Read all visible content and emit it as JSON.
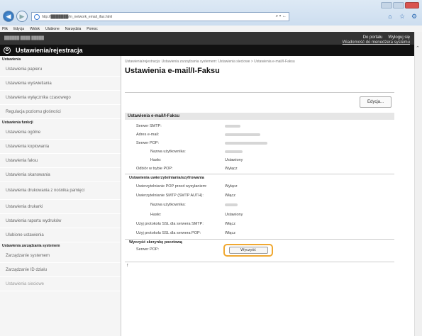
{
  "browser": {
    "url": "http://███████/m_network_email_ifax.html",
    "addr_controls": "⌕ ▾ ←",
    "menu": [
      "Plik",
      "Edycja",
      "Widok",
      "Ulubione",
      "Narzędzia",
      "Pomoc"
    ]
  },
  "topbar": {
    "device": "██████ ████ █████",
    "portal": "Do portalu",
    "logout": "Wyloguj się",
    "manager_msg": "Wiadomość do menedżera systemu"
  },
  "app": {
    "title": "Ustawienia/rejestracja"
  },
  "sidebar": {
    "group1": "Ustawienia",
    "items1": [
      "Ustawienia papieru",
      "Ustawienia wyświetlania",
      "Ustawienia wyłącznika czasowego",
      "Regulacja poziomu głośności"
    ],
    "group2": "Ustawienia funkcji",
    "items2": [
      "Ustawienia ogólne",
      "Ustawienia kopiowania",
      "Ustawienia faksu",
      "Ustawienia skanowania",
      "Ustawienia drukowania z nośnika pamięci",
      "Ustawienia drukarki",
      "Ustawienia raportu wydruków",
      "Ulubione ustawienia"
    ],
    "group3": "Ustawienia zarządzania systemem",
    "items3": [
      "Zarządzanie systemem",
      "Zarządzanie ID działu",
      "Ustawienia sieciowe"
    ]
  },
  "main": {
    "breadcrumb": "Ustawienia/rejestracja: Ustawienia zarządzania systemem: Ustawienia sieciowe > Ustawienia e-mail/I-Faksu",
    "title": "Ustawienia e-mail/I-Faksu",
    "edit_button": "Edycja...",
    "section1": "Ustawienia e-mail/I-Faksu",
    "smtp_server": "Serwer SMTP:",
    "email_address": "Adres e-mail:",
    "pop_server": "Serwer POP:",
    "username": "Nazwa użytkownika:",
    "password": "Hasło:",
    "password_val": "Ustawiony",
    "pop_receive": "Odbiór w trybie POP:",
    "pop_receive_val": "Wyłącz",
    "section2": "Ustawienia uwierzytelniania/szyfrowania",
    "pop_before": "Uwierzytelnianie POP przed wysyłaniem:",
    "pop_before_val": "Wyłącz",
    "smtp_auth": "Uwierzytelnianie SMTP (SMTP AUTH):",
    "smtp_auth_val": "Włącz",
    "username2": "Nazwa użytkownika:",
    "password2": "Hasło:",
    "password2_val": "Ustawiony",
    "ssl_smtp": "Użyj protokołu SSL dla serwera SMTP:",
    "ssl_smtp_val": "Włącz",
    "ssl_pop": "Użyj protokołu SSL dla serwera POP:",
    "ssl_pop_val": "Włącz",
    "section3": "Wyczyść skrzynkę pocztową",
    "pop_server2": "Serwer POP:",
    "clear_button": "Wyczyść",
    "to_top": "↑"
  }
}
